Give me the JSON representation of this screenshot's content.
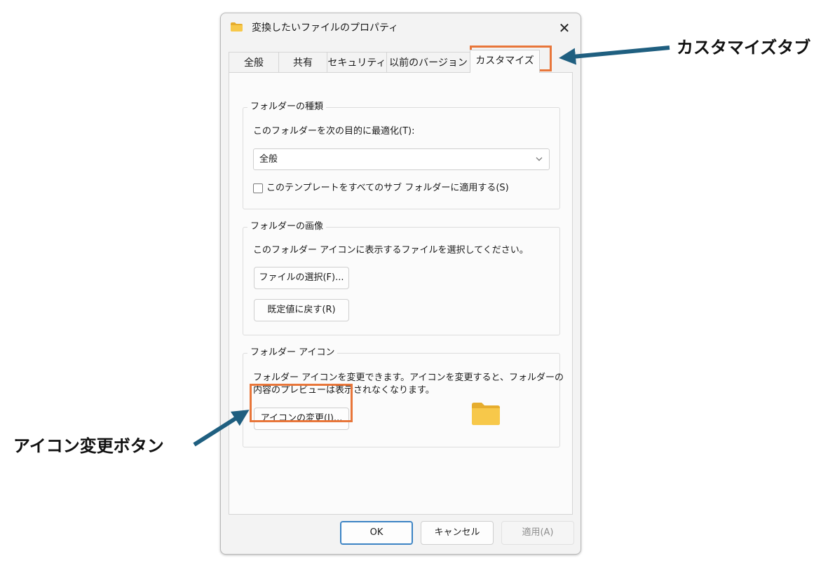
{
  "window": {
    "title": "変換したいファイルのプロパティ",
    "close_glyph": "✕"
  },
  "tabs": [
    {
      "label": "全般"
    },
    {
      "label": "共有"
    },
    {
      "label": "セキュリティ"
    },
    {
      "label": "以前のバージョン"
    },
    {
      "label": "カスタマイズ",
      "active": true
    }
  ],
  "folder_type": {
    "group_title": "フォルダーの種類",
    "optimize_label": "このフォルダーを次の目的に最適化(T):",
    "selected_value": "全般",
    "apply_subfolders_label": "このテンプレートをすべてのサブ フォルダーに適用する(S)",
    "apply_subfolders_checked": false
  },
  "folder_image": {
    "group_title": "フォルダーの画像",
    "description": "このフォルダー アイコンに表示するファイルを選択してください。",
    "choose_file_button": "ファイルの選択(F)...",
    "restore_default_button": "既定値に戻す(R)"
  },
  "folder_icon": {
    "group_title": "フォルダー アイコン",
    "description_line1": "フォルダー アイコンを変更できます。アイコンを変更すると、フォルダーの",
    "description_line2": "内容のプレビューは表示されなくなります。",
    "change_icon_button": "アイコンの変更(I)..."
  },
  "dialog_buttons": {
    "ok": "OK",
    "cancel": "キャンセル",
    "apply": "適用(A)"
  },
  "callouts": {
    "customize_tab": "カスタマイズタブ",
    "change_icon_button": "アイコン変更ボタン",
    "highlight_color": "#e8763a",
    "arrow_color": "#1f5f80"
  },
  "colors": {
    "folder_yellow": "#f7c84a",
    "folder_back": "#e6ad2e"
  }
}
